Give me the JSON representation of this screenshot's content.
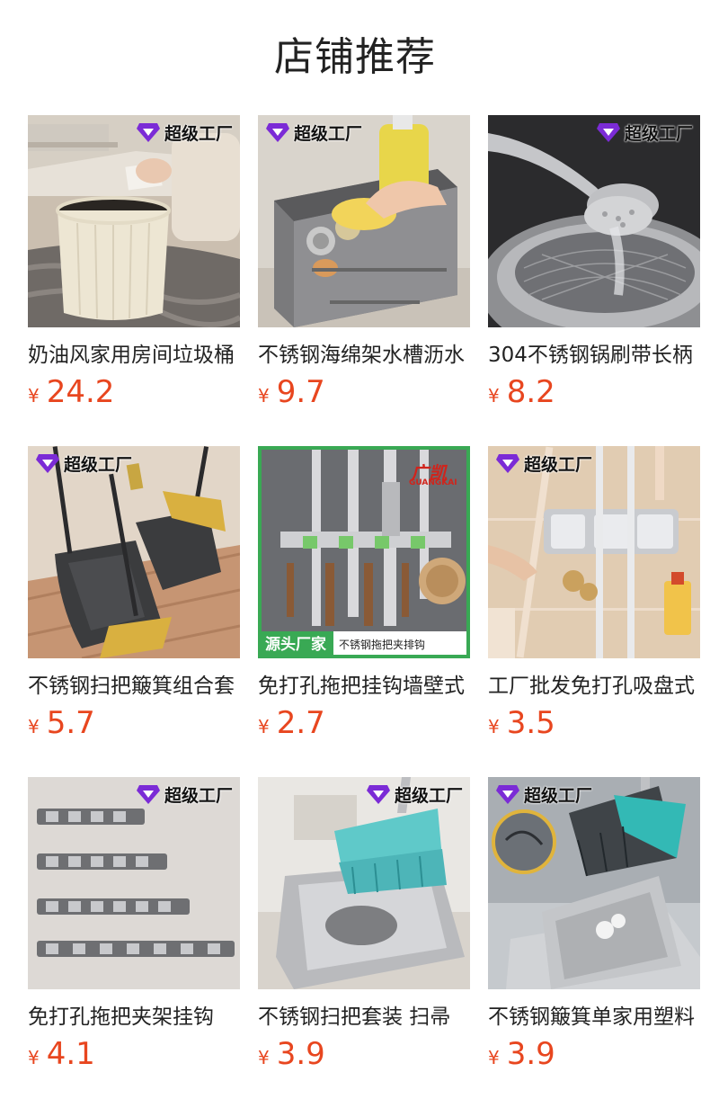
{
  "section_title": "店铺推荐",
  "currency_symbol": "¥",
  "badge_text": "超级工厂",
  "products": [
    {
      "name": "奶油风家用房间垃圾桶",
      "price": "24.2"
    },
    {
      "name": "不锈钢海绵架水槽沥水",
      "price": "9.7"
    },
    {
      "name": "304不锈钢锅刷带长柄",
      "price": "8.2"
    },
    {
      "name": "不锈钢扫把簸箕组合套",
      "price": "5.7"
    },
    {
      "name": "免打孔拖把挂钩墙壁式",
      "price": "2.7"
    },
    {
      "name": "工厂批发免打孔吸盘式",
      "price": "3.5"
    },
    {
      "name": "免打孔拖把夹架挂钩",
      "price": "4.1"
    },
    {
      "name": "不锈钢扫把套装 扫帚",
      "price": "3.9"
    },
    {
      "name": "不锈钢簸箕单家用塑料",
      "price": "3.9"
    }
  ],
  "product5_overlay": {
    "brand": "广凯",
    "brand_latin": "GUANGKAI",
    "tag": "源头厂家",
    "tag_desc": "不锈钢拖把夹排钩"
  },
  "colors": {
    "price": "#e8461f",
    "accent_green": "#39a954",
    "badge_gem": "#7b2bd6"
  }
}
